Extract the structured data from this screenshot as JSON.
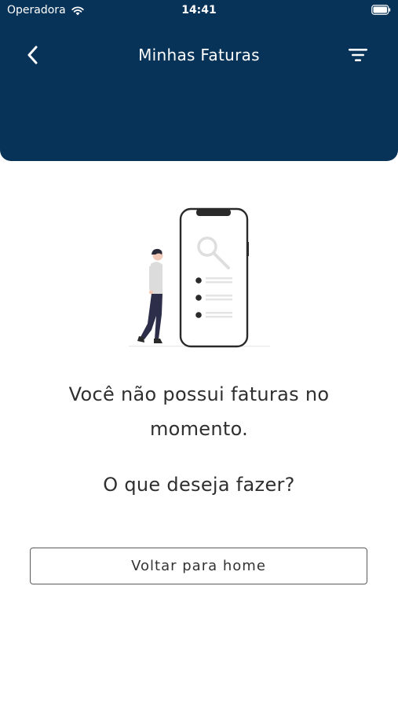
{
  "status_bar": {
    "carrier": "Operadora",
    "time": "14:41"
  },
  "header": {
    "title": "Minhas Faturas",
    "back_icon": "chevron-left-icon",
    "filter_icon": "filter-lines-icon",
    "background_color": "#083358"
  },
  "empty_state": {
    "message": "Você não possui faturas no momento.",
    "question": "O que deseja fazer?"
  },
  "actions": {
    "home_button_label": "Voltar para home"
  }
}
